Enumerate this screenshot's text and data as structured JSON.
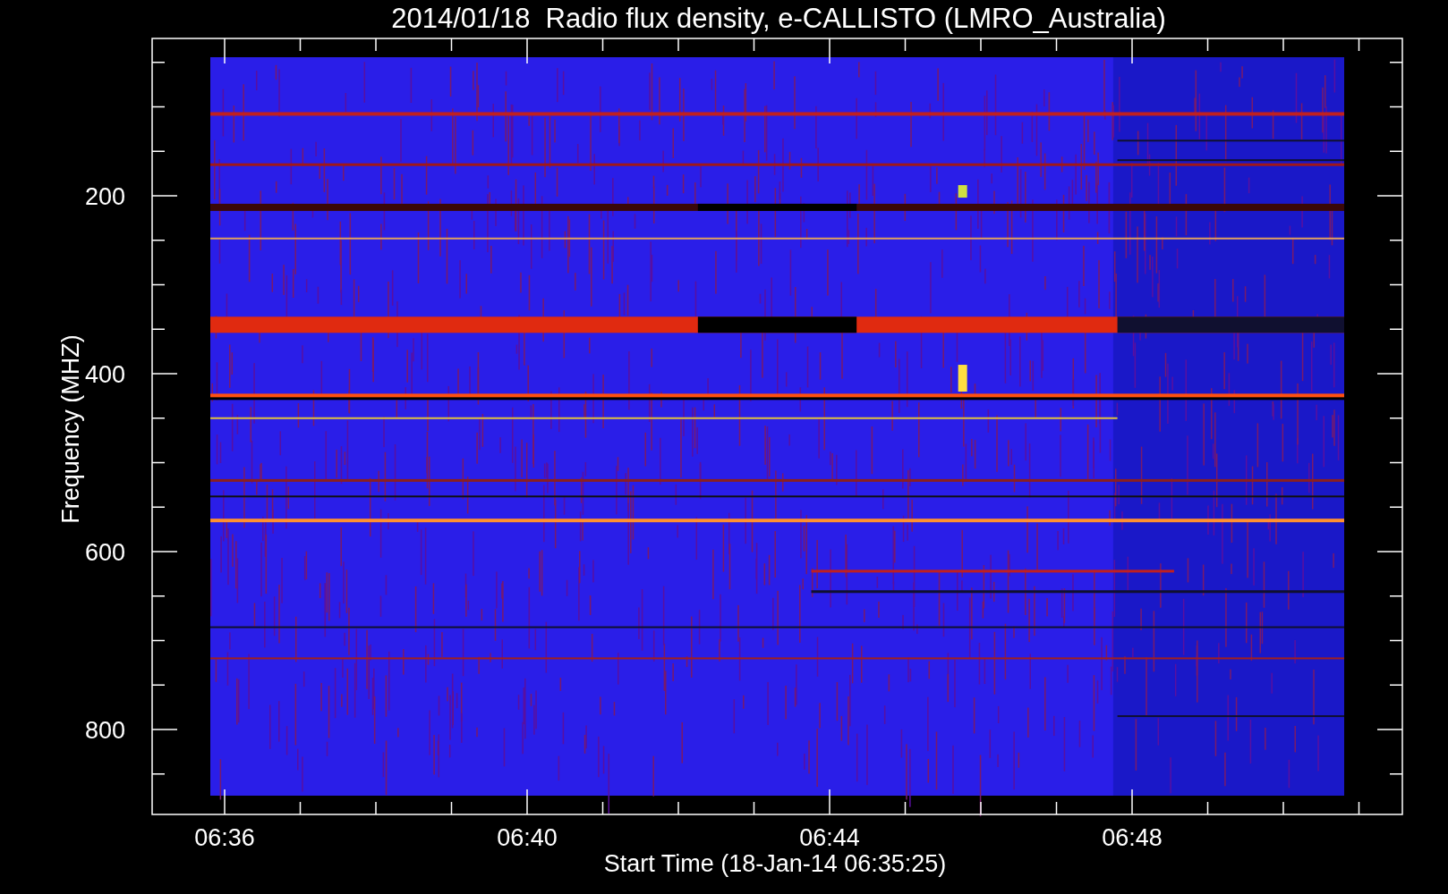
{
  "title": "2014/01/18  Radio flux density, e-CALLISTO (LMRO_Australia)",
  "y_axis": {
    "label": "Frequency (MHZ)",
    "ticks": [
      "200",
      "400",
      "600",
      "800"
    ]
  },
  "x_axis": {
    "label": "Start Time (18-Jan-14 06:35:25)",
    "ticks": [
      "06:36",
      "06:40",
      "06:44",
      "06:48"
    ]
  }
}
